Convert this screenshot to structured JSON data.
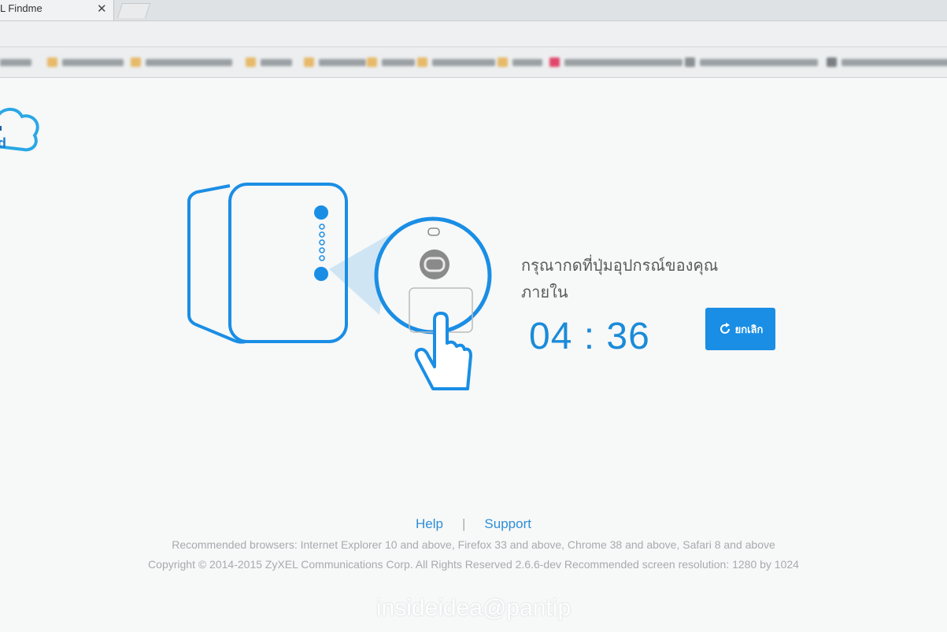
{
  "browser": {
    "tab_title": "L Findme",
    "tab_close": "✕"
  },
  "instruction": {
    "line1": "กรุณากดที่ปุ่มอุปกรณ์ของคุณ",
    "line2": "ภายใน"
  },
  "countdown": "04 : 36",
  "cancel_button": {
    "label": "ยกเลิก"
  },
  "footer": {
    "help": "Help",
    "separator": "|",
    "support": "Support",
    "browsers": "Recommended browsers: Internet Explorer 10 and above, Firefox 33 and above, Chrome 38 and above, Safari 8 and above",
    "copyright": "Copyright © 2014-2015 ZyXEL Communications Corp. All Rights Reserved 2.6.6-dev Recommended screen resolution: 1280 by 1024"
  },
  "watermark": "insideidea@pantip",
  "colors": {
    "accent": "#1a8ee5",
    "device_stroke": "#1a8ee5",
    "timer": "#1b8bd8"
  }
}
